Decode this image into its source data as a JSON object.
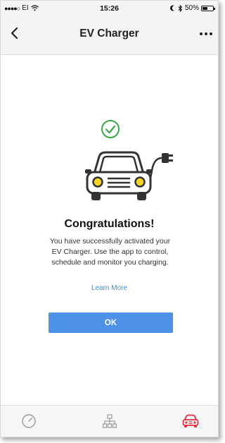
{
  "status_bar": {
    "carrier": "EI",
    "time": "15:26",
    "battery_percent": "50%"
  },
  "navbar": {
    "title": "EV Charger",
    "back_icon": "chevron-left-icon",
    "more_icon": "more-horizontal-icon"
  },
  "content": {
    "success_icon": "check-circle-icon",
    "illustration": "car-with-charging-plug",
    "headline": "Congratulations!",
    "message": "You have successfully activated your EV Charger. Use the app to control, schedule and monitor you charging.",
    "learn_more": "Learn More",
    "ok_button": "OK"
  },
  "tabbar": {
    "tabs": [
      {
        "icon": "speedometer-icon",
        "active": false
      },
      {
        "icon": "network-icon",
        "active": false
      },
      {
        "icon": "car-icon",
        "active": true
      }
    ]
  },
  "colors": {
    "accent_blue": "#4d92e8",
    "link_blue": "#3d8fd1",
    "success_green": "#3aa645",
    "active_tab_red": "#e03040",
    "car_yellow": "#f7d226"
  }
}
